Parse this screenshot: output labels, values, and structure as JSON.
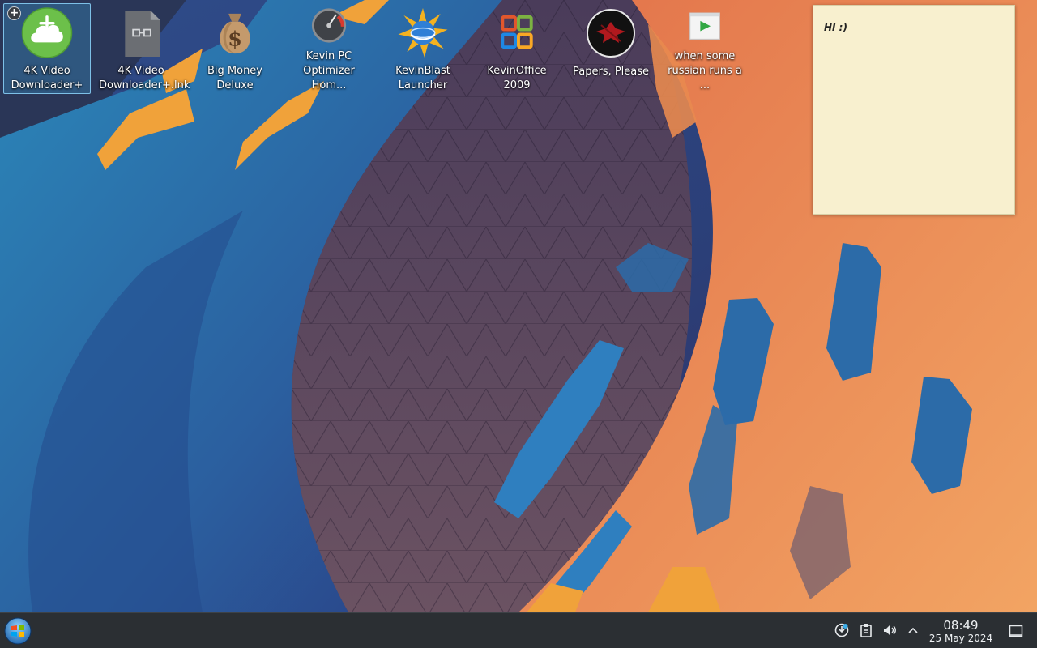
{
  "desktop": {
    "icons": [
      {
        "label": "4K Video Downloader+",
        "icon": "cloud-download-icon",
        "selected": true
      },
      {
        "label": "4K Video Downloader+.lnk",
        "icon": "shortcut-file-icon"
      },
      {
        "label": "Big Money Deluxe",
        "icon": "money-bag-icon"
      },
      {
        "label": "Kevin PC Optimizer Hom...",
        "icon": "speedometer-icon"
      },
      {
        "label": "KevinBlast Launcher",
        "icon": "globe-star-icon"
      },
      {
        "label": "KevinOffice 2009",
        "icon": "office-logo-icon"
      },
      {
        "label": "Papers, Please",
        "icon": "eagle-seal-icon"
      },
      {
        "label": "when some russian runs a ...",
        "icon": "video-play-icon"
      }
    ]
  },
  "sticky_note": {
    "text": "HI :)"
  },
  "taskbar": {
    "start_icon": "windows-orb-icon",
    "tray_icons": [
      "update-notifier-icon",
      "clipboard-icon",
      "volume-muted-icon",
      "chevron-up-icon"
    ],
    "clock": {
      "time": "08:49",
      "date": "25 May 2024"
    },
    "show_desktop_icon": "show-desktop-icon"
  },
  "colors": {
    "taskbar_bg": "#2b2f33",
    "selection_accent": "#3daee9",
    "note_bg": "#f8f0cf",
    "wallpaper_orange": "#e8894f",
    "wallpaper_blue": "#2f66a5"
  }
}
